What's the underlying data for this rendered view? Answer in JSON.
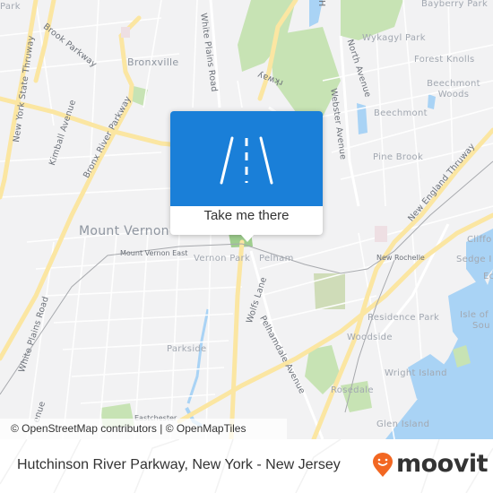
{
  "map": {
    "labels": {
      "park_top_left": "Park",
      "bronx_parkway_top": "Brook Parkway",
      "bronxville": "Bronxville",
      "white_plains_road_top": "White Plains Road",
      "ny_state_thruway": "New York State Thruway",
      "kimball_avenue": "Kimball Avenue",
      "bronx_river_parkway": "Bronx River Parkway",
      "parkway_fragment": "rkway",
      "webster_avenue": "Webster Avenue",
      "north_avenue": "North Avenue",
      "bayberry_park": "Bayberry Park",
      "wykagyl_park": "Wykagyl Park",
      "forest_knolls": "Forest Knolls",
      "beechmont_woods": "Beechmont Woods",
      "beechmont": "Beechmont",
      "pine_brook": "Pine Brook",
      "new_england_thruway": "New England Thruway",
      "mount_vernon": "Mount Vernon",
      "mount_vernon_east": "Mount Vernon East",
      "vernon_park": "Vernon Park",
      "pelham": "Pelham",
      "new_rochelle": "New Rochelle",
      "clifford": "Cliffo",
      "sedge_island": "Sedge I",
      "echo": "Ec",
      "isle_of": "Isle of",
      "south": "Sou",
      "white_plains_road_bottom": "White Plains Road",
      "wolfs_lane": "Wolfs Lane",
      "pelhamdale_avenue": "Pelhamdale Avenue",
      "parkside": "Parkside",
      "residence_park": "Residence Park",
      "woodside": "Woodside",
      "wright_island": "Wright Island",
      "rosedale": "Rosedale",
      "glen_island": "Glen Island",
      "eastchester": "Eastchester",
      "avenue_fragment": "enue",
      "h_fragment": "H"
    },
    "attribution": "© OpenStreetMap contributors | © OpenMapTiles"
  },
  "popup": {
    "icon": "road-icon",
    "cta_label": "Take me there",
    "accent_color": "#1a7fd8"
  },
  "footer": {
    "title": "Hutchinson River Parkway, New York - New Jersey",
    "brand": "moovit",
    "brand_color": "#f26722"
  }
}
